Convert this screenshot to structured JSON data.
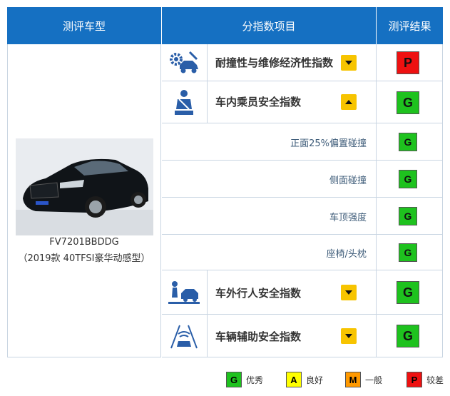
{
  "headers": {
    "model": "测评车型",
    "items": "分指数项目",
    "results": "测评结果"
  },
  "vehicle": {
    "code": "FV7201BBDDG",
    "desc": "（2019款 40TFSI豪华动感型）"
  },
  "rows": [
    {
      "label": "耐撞性与维修经济性指数",
      "rating": "P",
      "color": "#ee1111",
      "arrow": "down",
      "icon": "gear-car-repair-icon"
    },
    {
      "label": "车内乘员安全指数",
      "rating": "G",
      "color": "#1ec21e",
      "arrow": "up",
      "icon": "seated-occupant-seatbelt-icon"
    },
    {
      "label": "正面25%偏置碰撞",
      "rating": "G",
      "color": "#1ec21e"
    },
    {
      "label": "侧面碰撞",
      "rating": "G",
      "color": "#1ec21e"
    },
    {
      "label": "车顶强度",
      "rating": "G",
      "color": "#1ec21e"
    },
    {
      "label": "座椅/头枕",
      "rating": "G",
      "color": "#1ec21e"
    },
    {
      "label": "车外行人安全指数",
      "rating": "G",
      "color": "#1ec21e",
      "arrow": "down",
      "icon": "pedestrian-car-icon"
    },
    {
      "label": "车辆辅助安全指数",
      "rating": "G",
      "color": "#1ec21e",
      "arrow": "down",
      "icon": "lane-assist-car-icon"
    }
  ],
  "legend": [
    {
      "letter": "G",
      "text": "优秀",
      "color": "#1ec21e"
    },
    {
      "letter": "A",
      "text": "良好",
      "color": "#ffff00"
    },
    {
      "letter": "M",
      "text": "一般",
      "color": "#ff9900"
    },
    {
      "letter": "P",
      "text": "较差",
      "color": "#ee1111"
    }
  ]
}
